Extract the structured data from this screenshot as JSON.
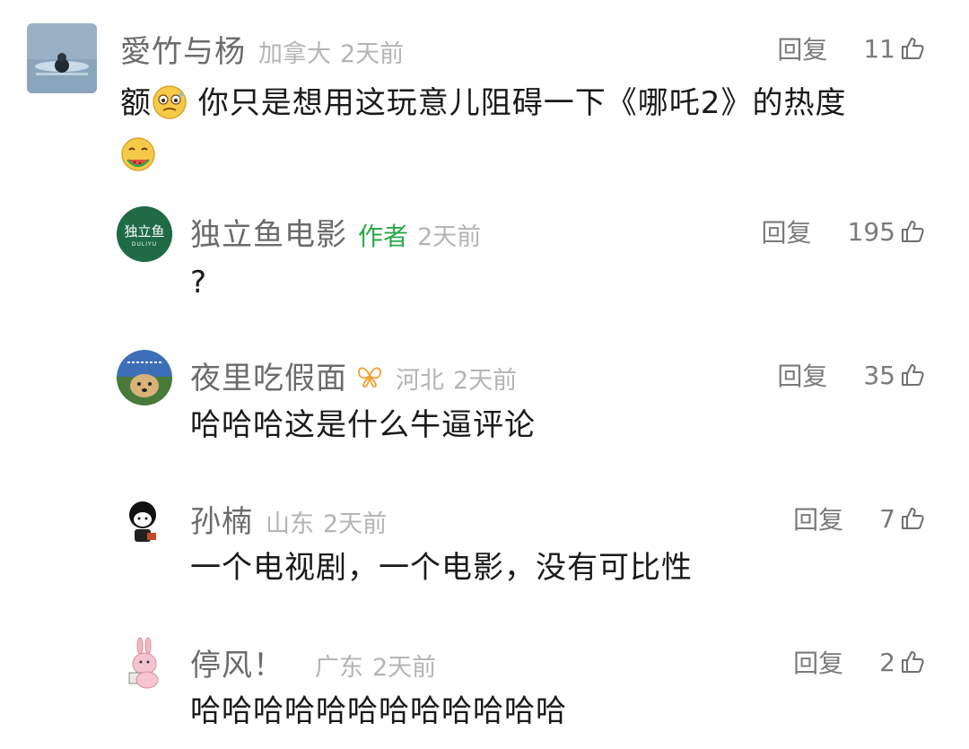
{
  "comments": [
    {
      "username": "愛竹与杨",
      "location": "加拿大",
      "time": "2天前",
      "reply_label": "回复",
      "likes": "11",
      "text_before": "额",
      "emoji1": "sweating-face-emoji",
      "text_after": " 你只是想用这玩意儿阻碍一下《哪吒2》的热度",
      "emoji2": "eating-watermelon-emoji"
    },
    {
      "username": "独立鱼电影",
      "badge": "作者",
      "time": "2天前",
      "reply_label": "回复",
      "likes": "195",
      "text": "?",
      "avatar_text": "独立鱼",
      "avatar_subtext": "DULIYU"
    },
    {
      "username": "夜里吃假面",
      "location": "河北",
      "time": "2天前",
      "reply_label": "回复",
      "likes": "35",
      "text": "哈哈哈这是什么牛逼评论",
      "badge_icon": "butterfly-icon"
    },
    {
      "username": "孙楠",
      "location": "山东",
      "time": "2天前",
      "reply_label": "回复",
      "likes": "7",
      "text": "一个电视剧，一个电影，没有可比性"
    },
    {
      "username": "停风！",
      "location": "广东",
      "time": "2天前",
      "reply_label": "回复",
      "likes": "2",
      "text": "哈哈哈哈哈哈哈哈哈哈哈哈"
    }
  ],
  "colors": {
    "author_green": "#2ca84a",
    "avatar_green": "#1f6b45",
    "badge_orange": "#f0a030"
  },
  "icons": {
    "like": "thumbs-up-icon",
    "butterfly": "butterfly-icon"
  }
}
